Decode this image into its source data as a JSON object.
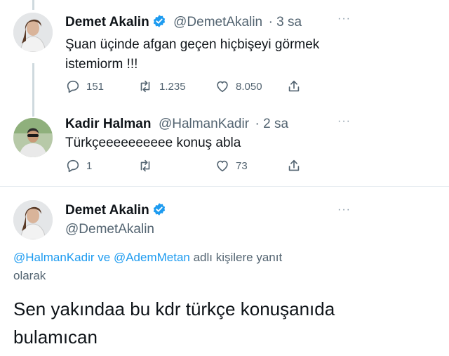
{
  "tweet1": {
    "name": "Demet Akalin",
    "handle": "@DemetAkalin",
    "time": "· 3 sa",
    "more": "···",
    "text_line1": "Şuan üçinde afgan geçen hiçbişeyi görmek",
    "text_line2": "istemiorm !!!",
    "replies": "151",
    "retweets": "1.235",
    "likes": "8.050"
  },
  "tweet2": {
    "name": "Kadir Halman",
    "handle": "@HalmanKadir",
    "time": "· 2 sa",
    "more": "···",
    "text": "Türkçeeeeeeeeee konuş abla",
    "replies": "1",
    "likes": "73"
  },
  "tweet3": {
    "name": "Demet Akalin",
    "handle": "@DemetAkalin",
    "more": "···",
    "reply_mention1": "@HalmanKadir",
    "reply_and": " ve ",
    "reply_mention2": "@AdemMetan",
    "reply_suffix": " adlı kişilere yanıt",
    "reply_line2": "olarak",
    "text_line1": "Sen yakındaa bu kdr türkçe konuşanıda",
    "text_line2": "bulamıcan"
  },
  "colors": {
    "accent": "#1d9bf0",
    "text": "#0f1419",
    "muted": "#536471",
    "verified": "#1d9bf0"
  },
  "icons": [
    "reply-icon",
    "retweet-icon",
    "like-icon",
    "share-icon",
    "verified-badge-icon",
    "more-icon"
  ]
}
